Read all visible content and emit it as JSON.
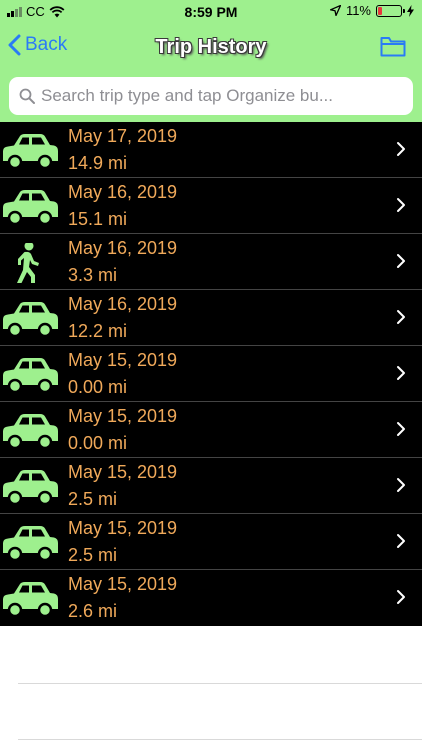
{
  "status_bar": {
    "carrier": "CC",
    "time": "8:59 PM",
    "battery_percent": "11%",
    "battery_color": "#e8383d",
    "icons": [
      "signal-icon",
      "wifi-icon",
      "location-arrow-icon",
      "battery-icon",
      "charging-bolt-icon"
    ]
  },
  "nav": {
    "back_label": "Back",
    "title": "Trip History",
    "right_icon": "folder-icon"
  },
  "search": {
    "placeholder": "Search trip type and tap Organize bu..."
  },
  "colors": {
    "header_bg": "#9ef08e",
    "accent_blue": "#2a7bf6",
    "row_text": "#f0a95a",
    "trip_icon": "#9ef08e",
    "list_bg": "#000000"
  },
  "trips": [
    {
      "type": "car-icon",
      "date": "May 17, 2019",
      "distance": "14.9 mi"
    },
    {
      "type": "car-icon",
      "date": "May 16, 2019",
      "distance": "15.1 mi"
    },
    {
      "type": "walking-icon",
      "date": "May 16, 2019",
      "distance": "3.3 mi"
    },
    {
      "type": "car-icon",
      "date": "May 16, 2019",
      "distance": "12.2 mi"
    },
    {
      "type": "car-icon",
      "date": "May 15, 2019",
      "distance": "0.00 mi"
    },
    {
      "type": "car-icon",
      "date": "May 15, 2019",
      "distance": "0.00 mi"
    },
    {
      "type": "car-icon",
      "date": "May 15, 2019",
      "distance": "2.5 mi"
    },
    {
      "type": "car-icon",
      "date": "May 15, 2019",
      "distance": "2.5 mi"
    },
    {
      "type": "car-icon",
      "date": "May 15, 2019",
      "distance": "2.6 mi"
    }
  ]
}
